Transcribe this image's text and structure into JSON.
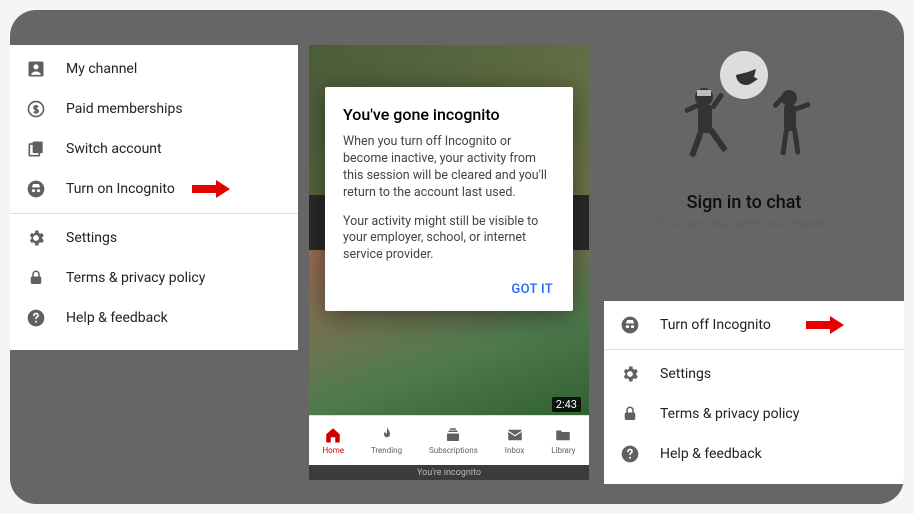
{
  "leftMenu": {
    "items": [
      {
        "label": "My channel"
      },
      {
        "label": "Paid memberships"
      },
      {
        "label": "Switch account"
      },
      {
        "label": "Turn on Incognito"
      },
      {
        "label": "Settings"
      },
      {
        "label": "Terms & privacy policy"
      },
      {
        "label": "Help & feedback"
      }
    ]
  },
  "dialog": {
    "title": "You've gone incognito",
    "p1": "When you turn off Incognito or become inactive, your activity from this session will be cleared and you'll return to the account last used.",
    "p2": "Your activity might still be visible to your employer, school, or internet service provider.",
    "action": "GOT IT"
  },
  "bottomNav": {
    "home": "Home",
    "trending": "Trending",
    "subs": "Subscriptions",
    "inbox": "Inbox",
    "library": "Library"
  },
  "incogBar": "You're incognito",
  "video": {
    "duration": "2:43"
  },
  "chat": {
    "title": "Sign in to chat",
    "subtitle": "You can chat with your friends"
  },
  "rightMenu": {
    "items": [
      {
        "label": "Turn off Incognito"
      },
      {
        "label": "Settings"
      },
      {
        "label": "Terms & privacy policy"
      },
      {
        "label": "Help & feedback"
      }
    ]
  }
}
